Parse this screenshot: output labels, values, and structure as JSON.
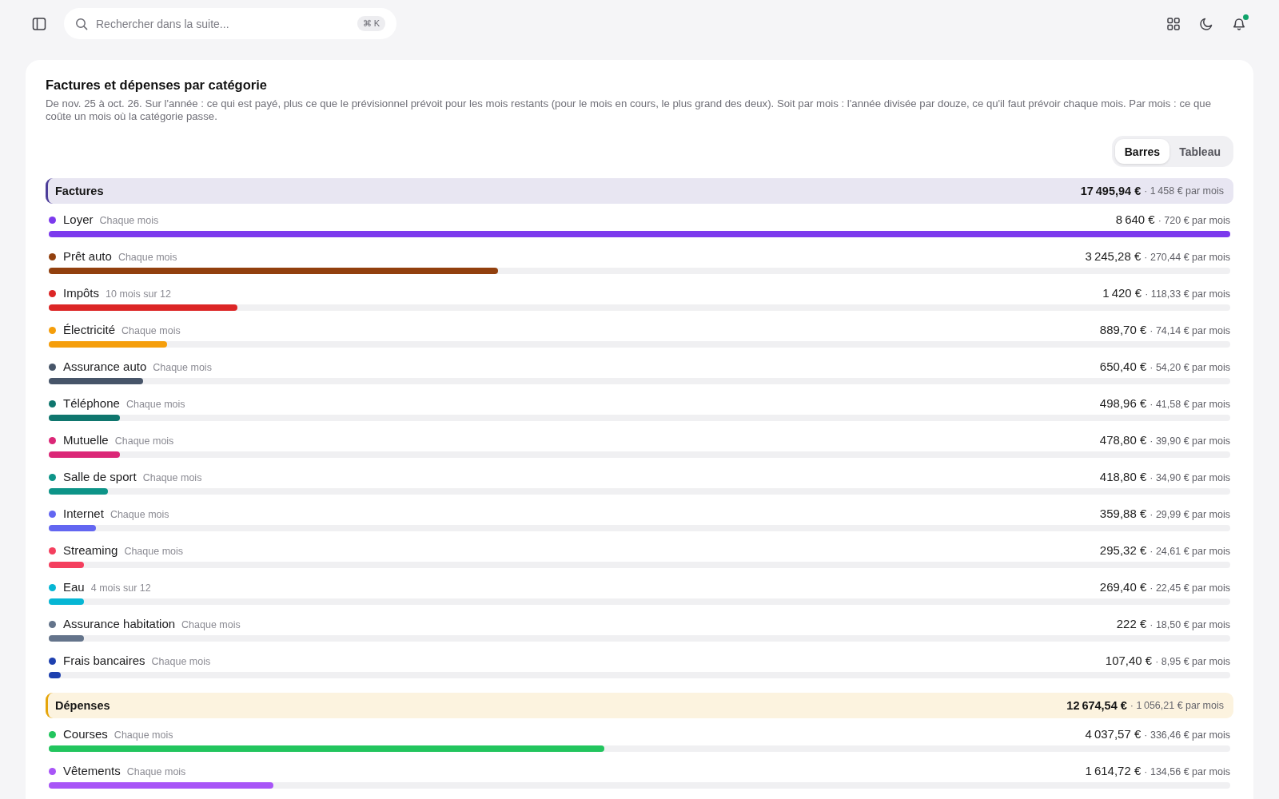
{
  "topbar": {
    "search": {
      "placeholder": "Rechercher dans la suite...",
      "shortcut": "⌘ K"
    },
    "notifications": {
      "unread": true
    }
  },
  "card": {
    "title": "Factures et dépenses par catégorie",
    "description": "De nov. 25 à oct. 26. Sur l'année : ce qui est payé, plus ce que le prévisionnel prévoit pour les mois restants (pour le mois en cours, le plus grand des deux). Soit par mois : l'année divisée par douze, ce qu'il faut prévoir chaque mois. Par mois : ce que coûte un mois où la catégorie passe.",
    "view_tabs": [
      {
        "label": "Barres",
        "selected": true
      },
      {
        "label": "Tableau",
        "selected": false
      }
    ],
    "groups": [
      {
        "name": "Factures",
        "color": "#4c3d99",
        "total": "17 495,94 €",
        "monthly": "· 1 458 € par mois",
        "items": [
          {
            "name": "Loyer",
            "frequency": "Chaque mois",
            "color": "#7c3aed",
            "level": 1,
            "total": "8 640 €",
            "monthly": "· 720 € par mois"
          },
          {
            "name": "Prêt auto",
            "frequency": "Chaque mois",
            "color": "#92400e",
            "level": 0.38,
            "total": "3 245,28 €",
            "monthly": "· 270,44 € par mois"
          },
          {
            "name": "Impôts",
            "frequency": "10 mois sur 12",
            "color": "#dc2626",
            "level": 0.16,
            "total": "1 420 €",
            "monthly": "· 118,33 € par mois"
          },
          {
            "name": "Électricité",
            "frequency": "Chaque mois",
            "color": "#f59e0b",
            "level": 0.1,
            "total": "889,70 €",
            "monthly": "· 74,14 € par mois"
          },
          {
            "name": "Assurance auto",
            "frequency": "Chaque mois",
            "color": "#475569",
            "level": 0.08,
            "total": "650,40 €",
            "monthly": "· 54,20 € par mois"
          },
          {
            "name": "Téléphone",
            "frequency": "Chaque mois",
            "color": "#0f766e",
            "level": 0.06,
            "total": "498,96 €",
            "monthly": "· 41,58 € par mois"
          },
          {
            "name": "Mutuelle",
            "frequency": "Chaque mois",
            "color": "#db2777",
            "level": 0.06,
            "total": "478,80 €",
            "monthly": "· 39,90 € par mois"
          },
          {
            "name": "Salle de sport",
            "frequency": "Chaque mois",
            "color": "#0d9488",
            "level": 0.05,
            "total": "418,80 €",
            "monthly": "· 34,90 € par mois"
          },
          {
            "name": "Internet",
            "frequency": "Chaque mois",
            "color": "#6366f1",
            "level": 0.04,
            "total": "359,88 €",
            "monthly": "· 29,99 € par mois"
          },
          {
            "name": "Streaming",
            "frequency": "Chaque mois",
            "color": "#f43f5e",
            "level": 0.03,
            "total": "295,32 €",
            "monthly": "· 24,61 € par mois"
          },
          {
            "name": "Eau",
            "frequency": "4 mois sur 12",
            "color": "#06b6d4",
            "level": 0.03,
            "total": "269,40 €",
            "monthly": "· 22,45 € par mois"
          },
          {
            "name": "Assurance habitation",
            "frequency": "Chaque mois",
            "color": "#64748b",
            "level": 0.03,
            "total": "222 €",
            "monthly": "· 18,50 € par mois"
          },
          {
            "name": "Frais bancaires",
            "frequency": "Chaque mois",
            "color": "#1e40af",
            "level": 0.01,
            "total": "107,40 €",
            "monthly": "· 8,95 € par mois"
          }
        ]
      },
      {
        "name": "Dépenses",
        "color": "#e5a50a",
        "total": "12 674,54 €",
        "monthly": "· 1 056,21 € par mois",
        "items": [
          {
            "name": "Courses",
            "frequency": "Chaque mois",
            "color": "#22c55e",
            "level": 0.47,
            "total": "4 037,57 €",
            "monthly": "· 336,46 € par mois"
          },
          {
            "name": "Vêtements",
            "frequency": "Chaque mois",
            "color": "#a855f7",
            "level": 0.19,
            "total": "1 614,72 €",
            "monthly": "· 134,56 € par mois"
          }
        ]
      }
    ]
  }
}
